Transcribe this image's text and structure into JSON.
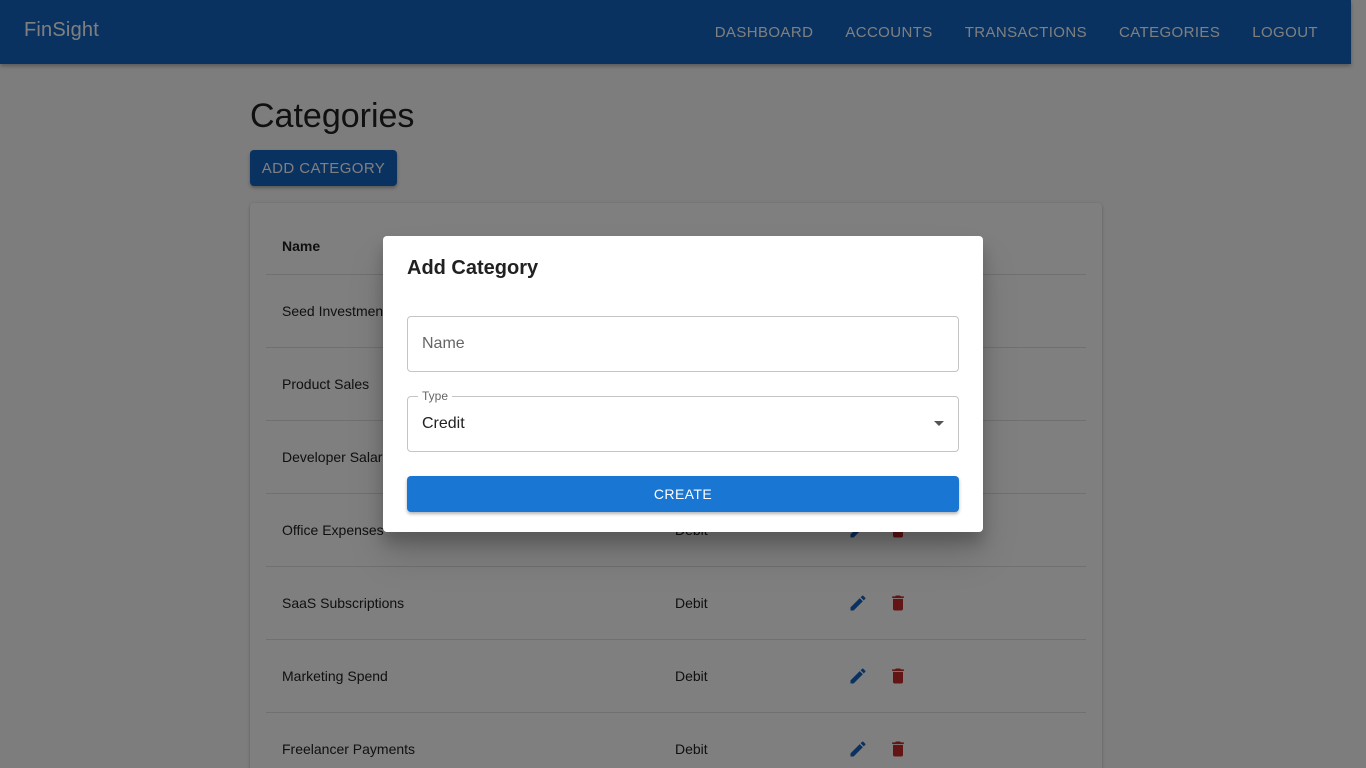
{
  "app": {
    "brand": "FinSight"
  },
  "nav": [
    {
      "label": "DASHBOARD"
    },
    {
      "label": "ACCOUNTS"
    },
    {
      "label": "TRANSACTIONS"
    },
    {
      "label": "CATEGORIES"
    },
    {
      "label": "LOGOUT"
    }
  ],
  "page": {
    "title": "Categories",
    "add_label": "ADD CATEGORY"
  },
  "table": {
    "headers": [
      "Name"
    ],
    "rows": [
      {
        "name": "Seed Investment",
        "type": ""
      },
      {
        "name": "Product Sales",
        "type": ""
      },
      {
        "name": "Developer Salaries",
        "type": ""
      },
      {
        "name": "Office Expenses",
        "type": "Debit"
      },
      {
        "name": "SaaS Subscriptions",
        "type": "Debit"
      },
      {
        "name": "Marketing Spend",
        "type": "Debit"
      },
      {
        "name": "Freelancer Payments",
        "type": "Debit"
      }
    ]
  },
  "dialog": {
    "title": "Add Category",
    "name_placeholder": "Name",
    "name_value": "",
    "type_label": "Type",
    "type_value": "Credit",
    "create_label": "CREATE"
  },
  "colors": {
    "primary": "#1565c0",
    "button": "#1976d2",
    "danger": "#c62828"
  }
}
